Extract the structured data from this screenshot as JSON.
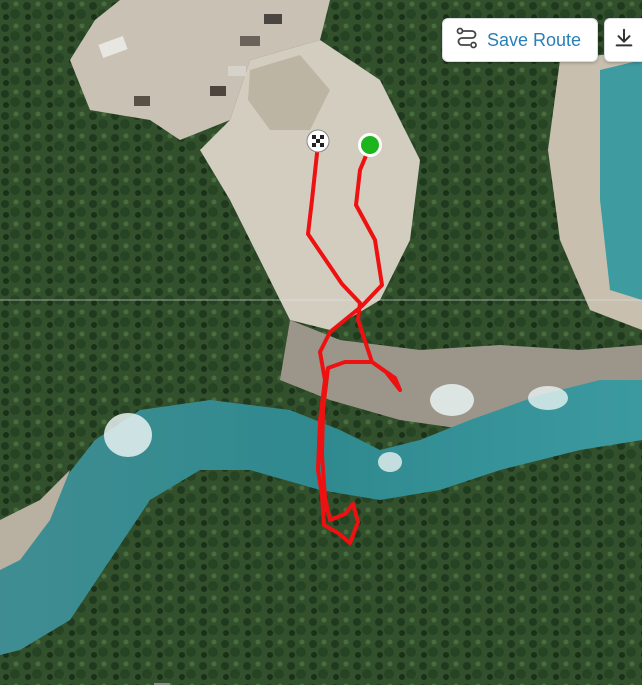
{
  "toolbar": {
    "save_route_label": "Save Route",
    "save_route_icon": "route-icon",
    "download_icon": "download-icon"
  },
  "map": {
    "view": "satellite",
    "start_marker_color": "#1db51d",
    "finish_marker_icon": "checkered-flag",
    "route_color": "#ee1111"
  }
}
